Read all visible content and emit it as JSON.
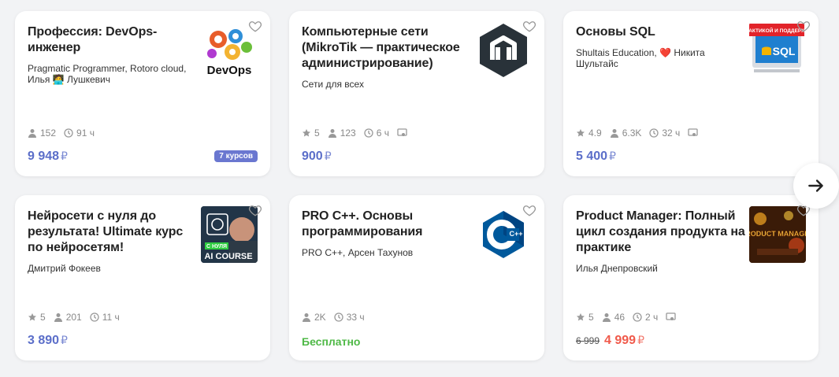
{
  "cards": [
    {
      "title": "Профессия: DevOps-инженер",
      "authors": "Pragmatic Programmer, Rotoro cloud, Илья 🧑‍💻 Лушкевич",
      "thumb_text": "DevOps",
      "students": "152",
      "duration": "91 ч",
      "price": "9 948",
      "currency": "₽",
      "badge": "7 курсов"
    },
    {
      "title": "Компьютерные сети (MikroTik — практическое администрирование)",
      "authors": "Сети для всех",
      "rating": "5",
      "students": "123",
      "duration": "6 ч",
      "price": "900",
      "currency": "₽"
    },
    {
      "title": "Основы SQL",
      "authors": "Shultais Education, ❤️ Никита Шультайс",
      "thumb_top_text": "С ПРАКТИКОЙ И ПОДДЕРЖКОЙ",
      "thumb_text": "SQL",
      "rating": "4.9",
      "students": "6.3K",
      "duration": "32 ч",
      "price": "5 400",
      "currency": "₽"
    },
    {
      "title": "Нейросети с нуля до результата! Ultimate курс по нейросетям!",
      "authors": "Дмитрий Фокеев",
      "thumb_tag": "С НУЛЯ",
      "thumb_text": "AI COURSE",
      "rating": "5",
      "students": "201",
      "duration": "11 ч",
      "price": "3 890",
      "currency": "₽"
    },
    {
      "title": "PRO C++. Основы программирования",
      "authors": "PRO C++, Арсен Тахунов",
      "thumb_text": "C++",
      "students": "2K",
      "duration": "33 ч",
      "price": "Бесплатно"
    },
    {
      "title": "Product Manager: Полный цикл создания продукта на практике",
      "authors": "Илья Днепровский",
      "thumb_text": "PRODUCT MANAGER",
      "rating": "5",
      "students": "46",
      "duration": "2 ч",
      "old_price": "6 999",
      "price": "4 999",
      "currency": "₽"
    }
  ],
  "colors": {
    "price": "#5b6ec9",
    "free": "#4fb947",
    "sale": "#f05a4b",
    "badge": "#6a77d0"
  },
  "icons": {
    "heart": "heart-icon",
    "rating": "star-icon",
    "students": "user-icon",
    "duration": "clock-icon",
    "certificate": "certificate-icon",
    "next": "arrow-right-icon"
  }
}
